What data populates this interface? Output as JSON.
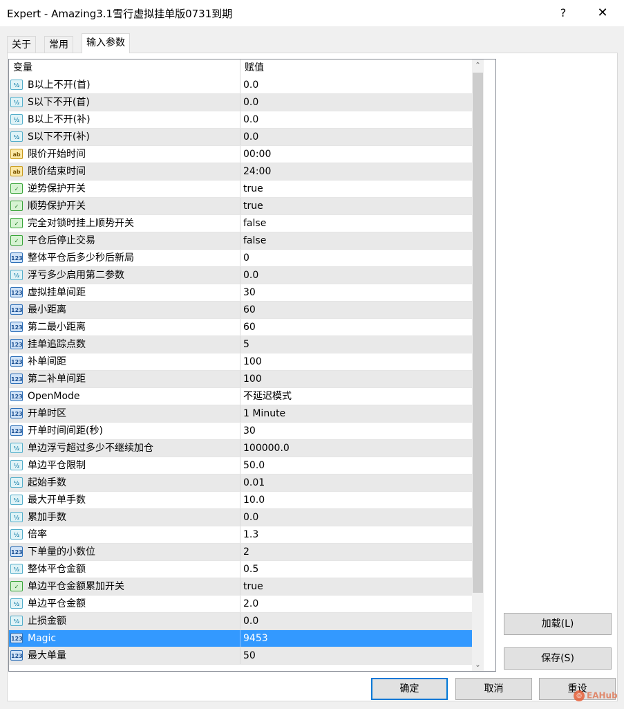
{
  "window": {
    "title": "Expert - Amazing3.1雪行虚拟挂单版0731到期",
    "help_label": "?",
    "close_label": "✕"
  },
  "tabs": [
    {
      "label": "关于",
      "active": false
    },
    {
      "label": "常用",
      "active": false
    },
    {
      "label": "输入参数",
      "active": true
    }
  ],
  "grid": {
    "headers": {
      "variable": "变量",
      "value": "赋值"
    },
    "rows": [
      {
        "type": "frac",
        "icon_text": "½",
        "name": "B以上不开(首)",
        "value": "0.0"
      },
      {
        "type": "frac",
        "icon_text": "½",
        "name": "S以下不开(首)",
        "value": "0.0"
      },
      {
        "type": "frac",
        "icon_text": "½",
        "name": "B以上不开(补)",
        "value": "0.0"
      },
      {
        "type": "frac",
        "icon_text": "½",
        "name": "S以下不开(补)",
        "value": "0.0"
      },
      {
        "type": "str",
        "icon_text": "ab",
        "name": "限价开始时间",
        "value": "00:00"
      },
      {
        "type": "str",
        "icon_text": "ab",
        "name": "限价结束时间",
        "value": "24:00"
      },
      {
        "type": "bool",
        "icon_text": "✓",
        "name": "逆势保护开关",
        "value": "true"
      },
      {
        "type": "bool",
        "icon_text": "✓",
        "name": "顺势保护开关",
        "value": "true"
      },
      {
        "type": "bool",
        "icon_text": "✓",
        "name": "完全对锁时挂上顺势开关",
        "value": "false"
      },
      {
        "type": "bool",
        "icon_text": "✓",
        "name": "平仓后停止交易",
        "value": "false"
      },
      {
        "type": "int",
        "icon_text": "123",
        "name": "整体平仓后多少秒后新局",
        "value": "0"
      },
      {
        "type": "frac",
        "icon_text": "½",
        "name": "浮亏多少启用第二参数",
        "value": "0.0"
      },
      {
        "type": "int",
        "icon_text": "123",
        "name": "虚拟挂单间距",
        "value": "30"
      },
      {
        "type": "int",
        "icon_text": "123",
        "name": "最小距离",
        "value": "60"
      },
      {
        "type": "int",
        "icon_text": "123",
        "name": "第二最小距离",
        "value": "60"
      },
      {
        "type": "int",
        "icon_text": "123",
        "name": "挂单追踪点数",
        "value": "5"
      },
      {
        "type": "int",
        "icon_text": "123",
        "name": "补单间距",
        "value": "100"
      },
      {
        "type": "int",
        "icon_text": "123",
        "name": "第二补单间距",
        "value": "100"
      },
      {
        "type": "int",
        "icon_text": "123",
        "name": "OpenMode",
        "value": "不延迟模式"
      },
      {
        "type": "int",
        "icon_text": "123",
        "name": "开单时区",
        "value": "1 Minute"
      },
      {
        "type": "int",
        "icon_text": "123",
        "name": "开单时间间距(秒)",
        "value": "30"
      },
      {
        "type": "frac",
        "icon_text": "½",
        "name": "单边浮亏超过多少不继续加仓",
        "value": "100000.0"
      },
      {
        "type": "frac",
        "icon_text": "½",
        "name": "单边平仓限制",
        "value": "50.0"
      },
      {
        "type": "frac",
        "icon_text": "½",
        "name": "起始手数",
        "value": "0.01"
      },
      {
        "type": "frac",
        "icon_text": "½",
        "name": "最大开单手数",
        "value": "10.0"
      },
      {
        "type": "frac",
        "icon_text": "½",
        "name": "累加手数",
        "value": "0.0"
      },
      {
        "type": "frac",
        "icon_text": "½",
        "name": "倍率",
        "value": "1.3"
      },
      {
        "type": "int",
        "icon_text": "123",
        "name": "下单量的小数位",
        "value": "2"
      },
      {
        "type": "frac",
        "icon_text": "½",
        "name": "整体平仓金额",
        "value": "0.5"
      },
      {
        "type": "bool",
        "icon_text": "✓",
        "name": "单边平仓金额累加开关",
        "value": "true"
      },
      {
        "type": "frac",
        "icon_text": "½",
        "name": "单边平仓金额",
        "value": "2.0"
      },
      {
        "type": "frac",
        "icon_text": "½",
        "name": "止损金额",
        "value": "0.0"
      },
      {
        "type": "int",
        "icon_text": "123",
        "name": "Magic",
        "value": "9453",
        "selected": true
      },
      {
        "type": "int",
        "icon_text": "123",
        "name": "最大单量",
        "value": "50"
      }
    ]
  },
  "buttons": {
    "load": "加载(L)",
    "save": "保存(S)",
    "ok": "确定",
    "cancel": "取消",
    "reset": "重设"
  },
  "watermark": "EAHub"
}
